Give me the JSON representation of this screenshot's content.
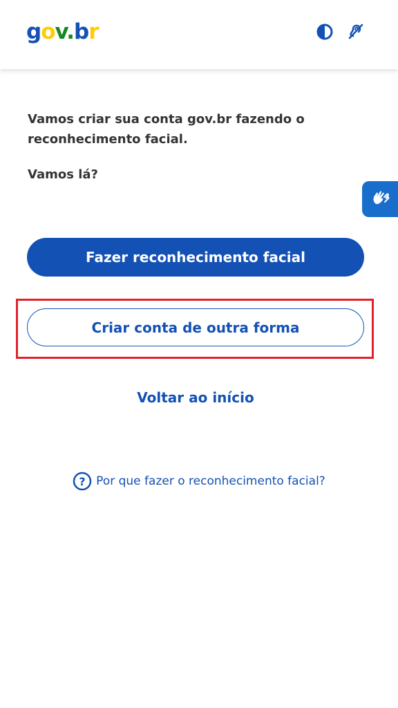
{
  "header": {
    "logo_parts": [
      "g",
      "o",
      "v",
      ".",
      "b",
      "r"
    ],
    "icons": [
      "contrast-icon",
      "accessibility-hearing-icon"
    ]
  },
  "main": {
    "intro": "Vamos criar sua conta gov.br fazendo o reconhecimento facial.",
    "question": "Vamos lá?",
    "primary_button": "Fazer reconhecimento facial",
    "secondary_button": "Criar conta de outra forma",
    "back_link": "Voltar ao início",
    "help_link": "Por que fazer o reconhecimento facial?"
  },
  "side_widget": {
    "icon": "sign-language-hands-icon"
  },
  "colors": {
    "primary": "#1351b4",
    "logo_blue": "#1351b4",
    "logo_yellow": "#ffcd07",
    "logo_green": "#168821",
    "highlight_border": "#e0212b",
    "text": "#333333"
  }
}
